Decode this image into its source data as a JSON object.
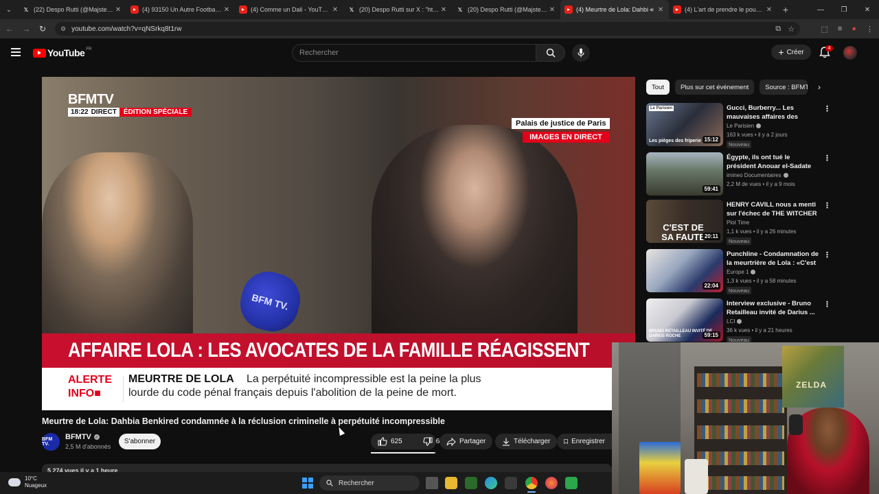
{
  "browser": {
    "tabs": [
      {
        "favicon": "x",
        "title": "(22) Despo Rutti (@MajsterOffi",
        "active": false
      },
      {
        "favicon": "youtube",
        "title": "(4) 93150 Un Autre Football Ep",
        "active": false
      },
      {
        "favicon": "youtube",
        "title": "(4) Comme un Dali - YouTube",
        "active": false
      },
      {
        "favicon": "x",
        "title": "(20) Despo Rutti sur X : \"https:/",
        "active": false
      },
      {
        "favicon": "x",
        "title": "(20) Despo Rutti (@MajsterOffi",
        "active": false
      },
      {
        "favicon": "youtube",
        "title": "(4) Meurtre de Lola: Dahbi",
        "active": true
      },
      {
        "favicon": "youtube",
        "title": "(4) L'art de prendre le pouvoir",
        "active": false
      }
    ],
    "url": "youtube.com/watch?v=qNSrkq8t1rw"
  },
  "youtube": {
    "logo_text": "YouTube",
    "country_code": "FR",
    "search_placeholder": "Rechercher",
    "create_label": "Créer",
    "notification_count": "4"
  },
  "video": {
    "overlay": {
      "channel_logo": "BFMTV",
      "time": "18:22",
      "direct": "DIRECT",
      "edition": "ÉDITION SPÉCIALE",
      "location": "Palais de justice de Paris",
      "location_sub": "IMAGES EN DIRECT",
      "mic_text": "BFM TV.",
      "headline": "AFFAIRE LOLA : LES AVOCATES DE LA FAMILLE RÉAGISSENT",
      "alert_line1": "ALERTE",
      "alert_line2": "INFO",
      "info_title": "MEURTRE DE LOLA",
      "info_text_line1": "La perpétuité incompressible est la peine la plus",
      "info_text_line2": "lourde du code pénal français depuis l'abolition de la peine de mort."
    },
    "title": "Meurtre de Lola: Dahbia Benkired condamnée à la réclusion criminelle à perpétuité incompressible",
    "channel": {
      "avatar_text": "BFM TV.",
      "name": "BFMTV",
      "subscribers": "2,5 M d'abonnés",
      "subscribe_label": "S'abonner"
    },
    "likes": "625",
    "dislikes": "6",
    "like_ratio": 0.98,
    "share_label": "Partager",
    "download_label": "Télécharger",
    "save_label": "Enregistrer",
    "description_peek": "5 274 vues  il y a 1 heure"
  },
  "chips": [
    "Tout",
    "Plus sur cet événement",
    "Source : BFMTV"
  ],
  "recommendations": [
    {
      "title": "Gucci, Burberry... Les mauvaises affaires des friperi...",
      "channel": "Le Parisien",
      "verified": true,
      "meta": "163 k vues • il y a 2 jours",
      "badge": "Nouveau",
      "duration": "15:12",
      "thumb_text": "Les pièges des friperie",
      "thumb_tag": "Le Parisien"
    },
    {
      "title": "Égypte, ils ont tué le président Anouar el-Sadate",
      "channel": "imineo Documentaires",
      "verified": true,
      "meta": "2,2 M de vues • il y a 9 mois",
      "badge": "",
      "duration": "59:41",
      "thumb_text": "",
      "thumb_tag": ""
    },
    {
      "title": "HENRY CAVILL nous a menti sur l'échec de THE WITCHER d...",
      "channel": "Plot Time",
      "verified": false,
      "meta": "1,1 k vues • il y a 26 minutes",
      "badge": "Nouveau",
      "duration": "20:11",
      "thumb_text": "C'EST DE SA FAUTE",
      "thumb_tag": ""
    },
    {
      "title": "Punchline - Condamnation de la meurtrière de Lola : «C'est une...",
      "channel": "Europe 1",
      "verified": true,
      "meta": "1,3 k vues • il y a 58 minutes",
      "badge": "Nouveau",
      "duration": "22:04",
      "thumb_text": "",
      "thumb_tag": ""
    },
    {
      "title": "Interview exclusive - Bruno Retailleau invité de Darius ...",
      "channel": "LCI",
      "verified": true,
      "meta": "36 k vues • il y a 21 heures",
      "badge": "Nouveau",
      "duration": "59:15",
      "thumb_text": "BRUNO RETAILLEAU INVITÉ DE DARIUS ROCHE",
      "thumb_tag": ""
    }
  ],
  "webcam": {
    "poster_text": "ZELDA"
  },
  "taskbar": {
    "temperature": "10°C",
    "weather": "Nuageux",
    "search_label": "Rechercher"
  },
  "colors": {
    "youtube_red": "#ff0000",
    "bfm_red": "#e2001a",
    "background": "#0f0f0f"
  }
}
